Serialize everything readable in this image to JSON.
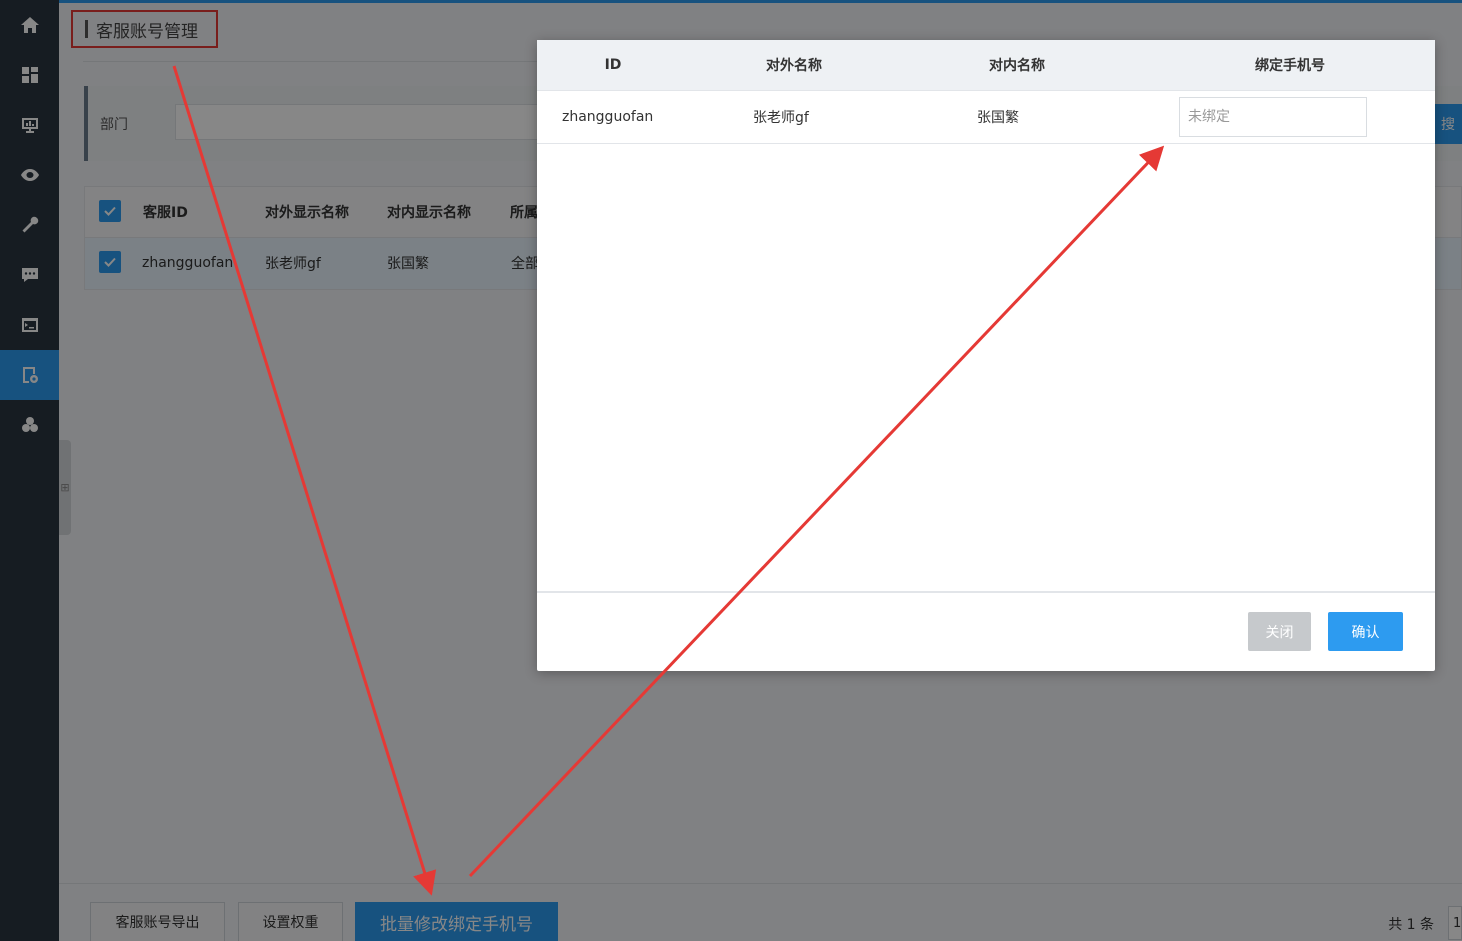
{
  "page": {
    "title": "客服账号管理"
  },
  "sidebar": {
    "items": [
      {
        "icon": "home-icon"
      },
      {
        "icon": "dashboard-icon"
      },
      {
        "icon": "monitor-chart-icon"
      },
      {
        "icon": "eye-icon"
      },
      {
        "icon": "wrench-icon"
      },
      {
        "icon": "chat-icon"
      },
      {
        "icon": "terminal-icon"
      },
      {
        "icon": "settings-page-icon",
        "active": true
      },
      {
        "icon": "clover-icon"
      }
    ],
    "collapse_label": "⊞"
  },
  "filter": {
    "dept_label": "部门",
    "search_label": "搜"
  },
  "table": {
    "columns": [
      "客服ID",
      "对外显示名称",
      "对内显示名称",
      "所属"
    ],
    "rows": [
      {
        "id": "zhangguofan",
        "external": "张老师gf",
        "internal": "张国繁",
        "dept": "全部"
      }
    ]
  },
  "footer": {
    "export_label": "客服账号导出",
    "weight_label": "设置权重",
    "batch_label": "批量修改绑定手机号",
    "total_label": "共 1 条",
    "page_value": "1"
  },
  "modal": {
    "columns": [
      "ID",
      "对外名称",
      "对内名称",
      "绑定手机号"
    ],
    "row": {
      "id": "zhangguofan",
      "external": "张老师gf",
      "internal": "张国繁",
      "phone_placeholder": "未绑定"
    },
    "close_label": "关闭",
    "confirm_label": "确认"
  },
  "colors": {
    "accent": "#2d9bf0",
    "sidebar": "#2b3640",
    "annotation": "#e53935"
  }
}
